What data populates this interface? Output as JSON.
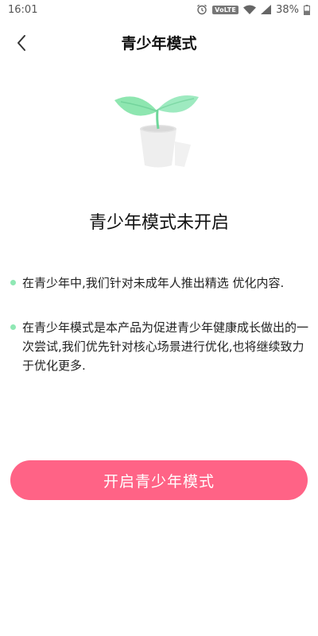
{
  "status_bar": {
    "time": "16:01",
    "volte": "VoLTE",
    "battery": "38%",
    "icons": [
      "alarm-icon",
      "wifi-icon",
      "signal-icon",
      "battery-icon"
    ]
  },
  "header": {
    "title": "青少年模式",
    "back_icon": "chevron-left-icon"
  },
  "illustration": {
    "icon": "plant-pot-icon",
    "colors": {
      "leaf": "#8ee6b0",
      "pot": "#eeeeee"
    }
  },
  "status_title": "青少年模式未开启",
  "info_items": [
    {
      "text": "在青少年中,我们针对未成年人推出精选 优化内容."
    },
    {
      "text": "在青少年模式是本产品为促进青少年健康成长做出的一次尝试,我们优先针对核心场景进行优化,也将继续致力于优化更多."
    }
  ],
  "enable_button": {
    "label": "开启青少年模式",
    "color": "#ff6386"
  }
}
